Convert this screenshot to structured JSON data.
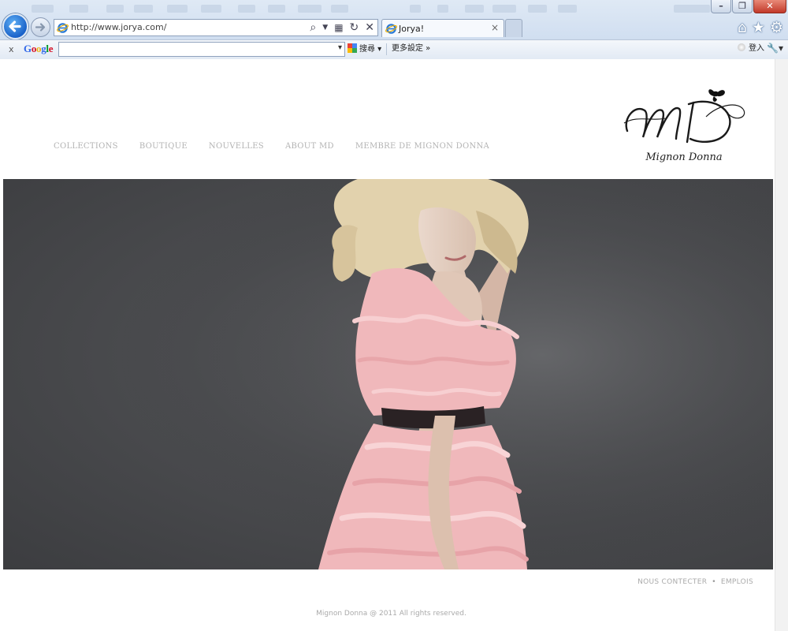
{
  "browser": {
    "url": "http://www.jorya.com/",
    "tab_title": "Jorya!",
    "tab_close": "×",
    "window_buttons": {
      "minimize": "–",
      "restore": "❐",
      "close": "✕"
    }
  },
  "google_toolbar": {
    "close": "x",
    "logo": "Google",
    "search_button": "搜尋",
    "more_settings": "更多設定 »",
    "login": "登入"
  },
  "site": {
    "nav": [
      "COLLECTIONS",
      "BOUTIQUE",
      "NOUVELLES",
      "ABOUT MD",
      "MEMBRE DE MIGNON DONNA"
    ],
    "logo": {
      "monogram": "MD",
      "caption": "Mignon Donna"
    },
    "footer": {
      "links": [
        "NOUS CONTECTER",
        "EMPLOIS"
      ],
      "separator": "•",
      "copyright": "Mignon Donna @ 2011 All rights reserved."
    }
  },
  "icons": {
    "back": "back-arrow-icon",
    "forward": "forward-arrow-icon",
    "home": "home-icon",
    "favorites": "star-icon",
    "tools": "gear-icon"
  },
  "colors": {
    "nav_text": "#b3b3b3",
    "hero_bg": "#4b4c4f",
    "dress": "#f0b8bb",
    "ie_blue": "#1a62c9"
  }
}
